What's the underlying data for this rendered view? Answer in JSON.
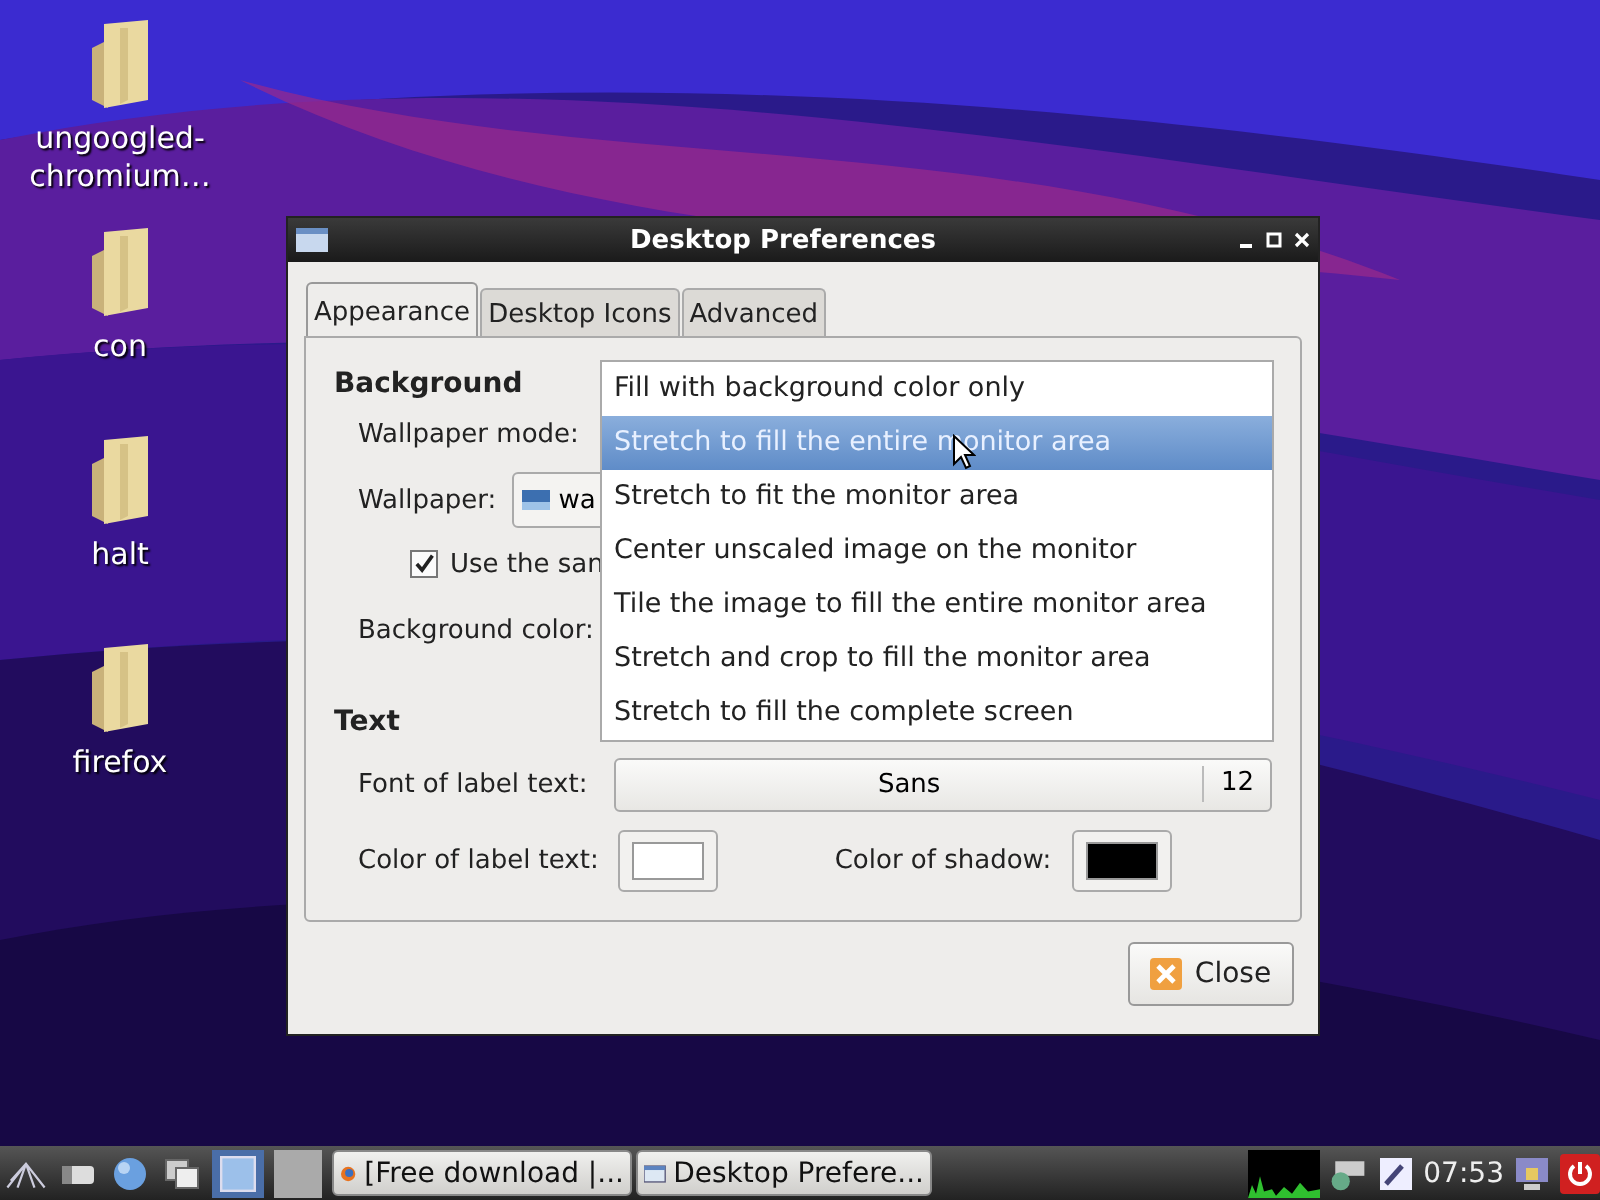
{
  "desktop_icons": [
    {
      "label": "ungoogled-chromium…"
    },
    {
      "label": "con"
    },
    {
      "label": "halt"
    },
    {
      "label": "firefox"
    }
  ],
  "window": {
    "title": "Desktop Preferences"
  },
  "tabs": [
    {
      "label": "Appearance",
      "selected": true
    },
    {
      "label": "Desktop Icons",
      "selected": false
    },
    {
      "label": "Advanced",
      "selected": false
    }
  ],
  "background": {
    "heading": "Background",
    "wallpaper_mode_label": "Wallpaper mode:",
    "wallpaper_label": "Wallpaper:",
    "wallpaper_value": "wa",
    "same_checkbox": {
      "label": "Use the san",
      "checked": true
    },
    "background_color_label": "Background color:"
  },
  "wallpaper_mode_options": [
    {
      "label": "Fill with background color only",
      "selected": false
    },
    {
      "label": "Stretch to fill the entire monitor area",
      "selected": true
    },
    {
      "label": "Stretch to fit the monitor area",
      "selected": false
    },
    {
      "label": "Center unscaled image on the monitor",
      "selected": false
    },
    {
      "label": "Tile the image to fill the entire monitor area",
      "selected": false
    },
    {
      "label": "Stretch and crop to fill the monitor area",
      "selected": false
    },
    {
      "label": "Stretch to fill the complete screen",
      "selected": false
    }
  ],
  "text": {
    "heading": "Text",
    "font_label": "Font of label text:",
    "font_name": "Sans",
    "font_size": "12",
    "color_buttons": [
      {
        "label": "Color of label text:",
        "color": "#ffffff"
      },
      {
        "label": "Color of shadow:",
        "color": "#000000"
      }
    ]
  },
  "close_button": "Close",
  "taskbar": {
    "tasks": [
      {
        "label": "[Free download |...",
        "kind": "browser"
      },
      {
        "label": "Desktop Prefere...",
        "kind": "window"
      }
    ],
    "clock": "07:53"
  }
}
